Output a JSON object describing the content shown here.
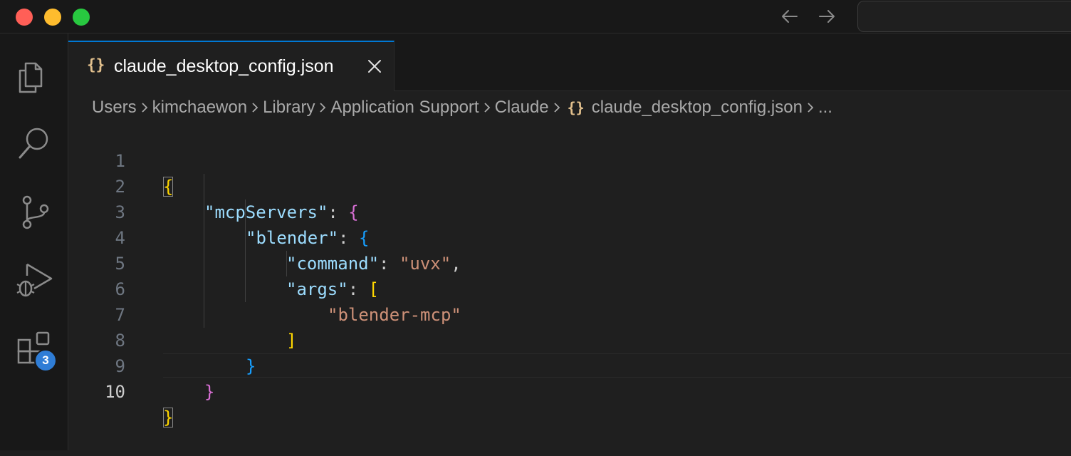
{
  "window": {
    "nav": {
      "back_icon": "arrow-left-icon",
      "forward_icon": "arrow-right-icon"
    }
  },
  "activity_bar": {
    "items": [
      {
        "name": "explorer",
        "icon": "files-icon"
      },
      {
        "name": "search",
        "icon": "search-icon"
      },
      {
        "name": "source-control",
        "icon": "source-control-icon"
      },
      {
        "name": "run-and-debug",
        "icon": "run-debug-icon"
      },
      {
        "name": "extensions",
        "icon": "extensions-icon",
        "badge": "3"
      }
    ]
  },
  "tab": {
    "icon_glyph": "{}",
    "label": "claude_desktop_config.json",
    "close_icon": "close-icon"
  },
  "breadcrumbs": {
    "items": [
      "Users",
      "kimchaewon",
      "Library",
      "Application Support",
      "Claude"
    ],
    "file_icon_glyph": "{}",
    "file": "claude_desktop_config.json",
    "more": "..."
  },
  "editor": {
    "line_numbers": [
      "1",
      "2",
      "3",
      "4",
      "5",
      "6",
      "7",
      "8",
      "9",
      "10"
    ],
    "active_line": "10",
    "tokens": {
      "l1_open": "{",
      "l2_key": "\"mcpServers\"",
      "l2_colon": ": ",
      "l2_open": "{",
      "l3_key": "\"blender\"",
      "l3_colon": ": ",
      "l3_open": "{",
      "l4_key": "\"command\"",
      "l4_colon": ": ",
      "l4_value": "\"uvx\"",
      "l4_comma": ",",
      "l5_key": "\"args\"",
      "l5_colon": ": ",
      "l5_open": "[",
      "l6_value": "\"blender-mcp\"",
      "l7_close": "]",
      "l8_close": "}",
      "l9_close": "}",
      "l10_close": "}"
    }
  },
  "colors": {
    "key": "#9cdcfe",
    "string": "#ce9178",
    "bracket_level1": "#ffd700",
    "bracket_level2": "#da70d6",
    "bracket_level3": "#179fff",
    "accent": "#0078d4"
  }
}
